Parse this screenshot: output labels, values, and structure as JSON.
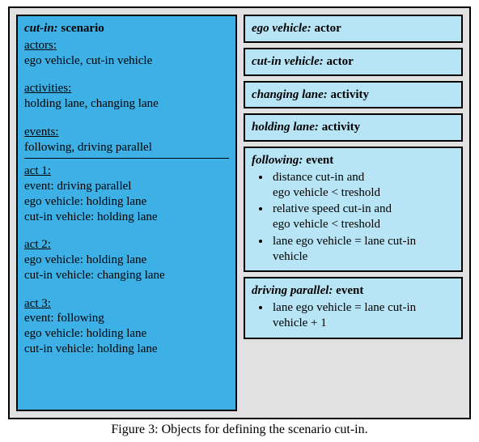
{
  "main": {
    "title_key": "cut-in:",
    "title_val": "scenario",
    "actors_h": "actors:",
    "actors_v": "ego vehicle, cut-in vehicle",
    "activities_h": "activities:",
    "activities_v": "holding lane, changing lane",
    "events_h": "events:",
    "events_v": "following, driving parallel",
    "act1_h": "act 1:",
    "act1_l1": "event: driving parallel",
    "act1_l2": "ego vehicle: holding lane",
    "act1_l3": "cut-in vehicle: holding lane",
    "act2_h": "act 2:",
    "act2_l1": "ego vehicle: holding lane",
    "act2_l2": "cut-in vehicle: changing lane",
    "act3_h": "act 3:",
    "act3_l1": "event: following",
    "act3_l2": "ego vehicle: holding lane",
    "act3_l3": "cut-in vehicle: holding lane"
  },
  "side": {
    "ego_key": "ego vehicle:",
    "ego_val": "actor",
    "cutin_key": "cut-in vehicle:",
    "cutin_val": "actor",
    "chlane_key": "changing lane:",
    "chlane_val": "activity",
    "hlane_key": "holding lane:",
    "hlane_val": "activity",
    "following_key": "following:",
    "following_val": "event",
    "following_b1a": "distance cut-in and",
    "following_b1b": "ego vehicle < treshold",
    "following_b2a": "relative speed cut-in and",
    "following_b2b": "ego vehicle < treshold",
    "following_b3a": "lane ego vehicle = lane cut-in",
    "following_b3b": "vehicle",
    "parallel_key": "driving parallel:",
    "parallel_val": "event",
    "parallel_b1a": "lane ego vehicle = lane cut-in",
    "parallel_b1b": "vehicle + 1"
  },
  "caption": "Figure 3: Objects for defining the scenario cut-in."
}
